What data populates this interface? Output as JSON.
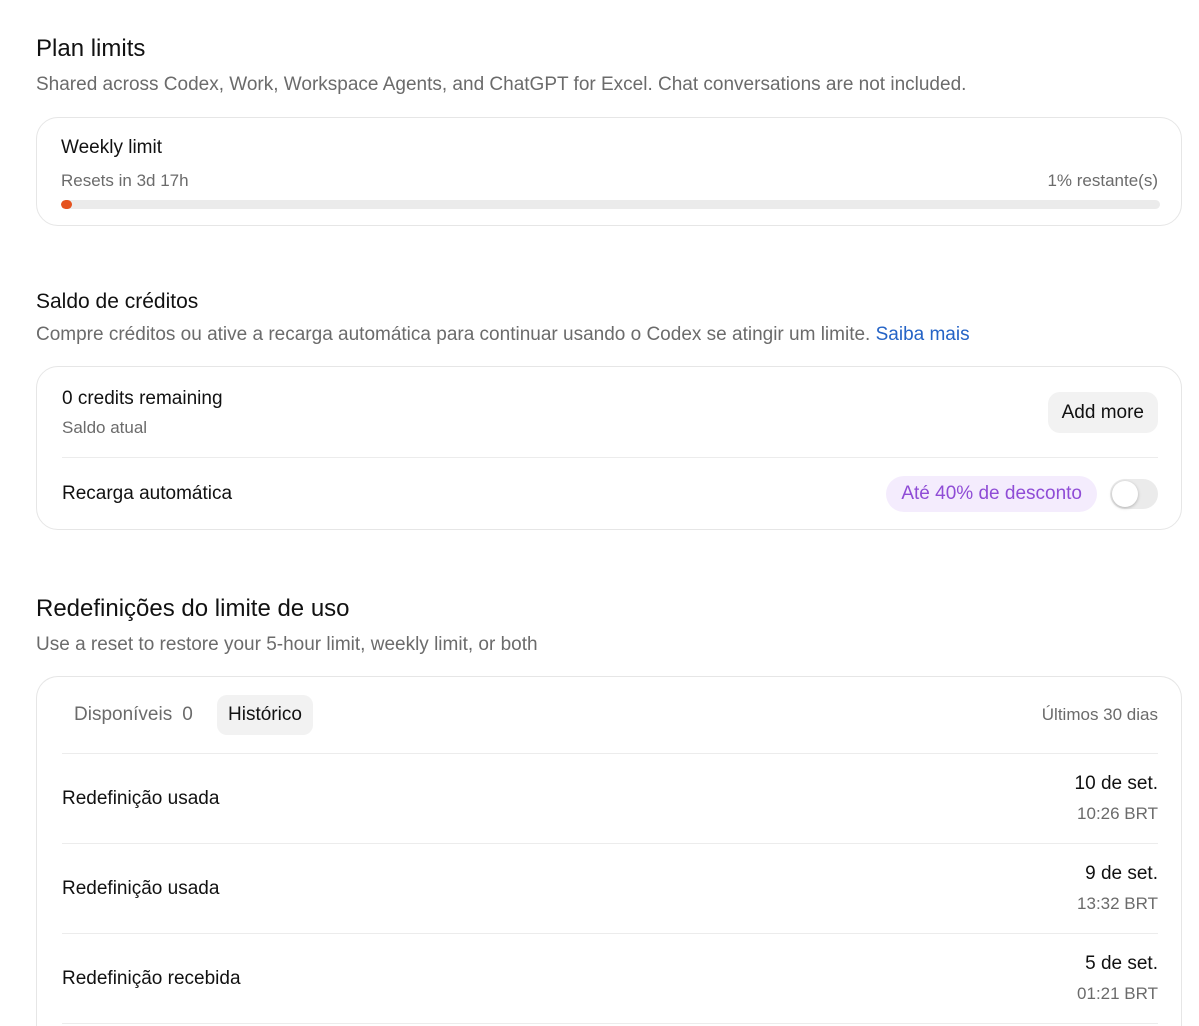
{
  "plan_limits": {
    "title": "Plan limits",
    "description": "Shared across Codex, Work, Workspace Agents, and ChatGPT for Excel. Chat conversations are not included.",
    "weekly": {
      "title": "Weekly limit",
      "resets": "Resets in 3d 17h",
      "remaining_text": "1% restante(s)",
      "remaining_fraction": 0.01,
      "bar_color": "#e5531f"
    }
  },
  "credits": {
    "title": "Saldo de créditos",
    "description": "Compre créditos ou ative a recarga automática para continuar usando o Codex se atingir um limite.",
    "learn_more": "Saiba mais",
    "link_color": "#2463c6",
    "remaining_label": "0 credits remaining",
    "balance_label": "Saldo atual",
    "add_more_label": "Add more",
    "auto_recharge_label": "Recarga automática",
    "discount_badge": "Até 40% de desconto",
    "auto_recharge_enabled": false
  },
  "resets": {
    "title": "Redefinições do limite de uso",
    "description": "Use a reset to restore your 5-hour limit, weekly limit, or both",
    "tabs": {
      "available_label": "Disponíveis",
      "available_count": "0",
      "history_label": "Histórico",
      "active": "history"
    },
    "period": "Últimos 30 dias",
    "history": [
      {
        "label": "Redefinição usada",
        "date": "10 de set.",
        "time": "10:26 BRT"
      },
      {
        "label": "Redefinição usada",
        "date": "9 de set.",
        "time": "13:32 BRT"
      },
      {
        "label": "Redefinição recebida",
        "date": "5 de set.",
        "time": "01:21 BRT"
      }
    ]
  }
}
